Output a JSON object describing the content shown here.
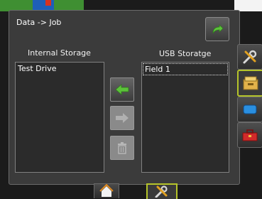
{
  "dialog": {
    "title": "Data -> Job",
    "internal_label": "Internal Storage",
    "usb_label": "USB Storatge",
    "internal_items": [
      "Test Drive"
    ],
    "usb_items": [
      "Field 1"
    ],
    "selected_usb_item": "Field 1"
  },
  "buttons": {
    "back_icon": "curved-arrow-icon",
    "copy_to_internal_icon": "arrow-left-icon",
    "copy_to_usb_icon": "arrow-right-icon",
    "delete_icon": "trash-icon"
  },
  "side_tabs": [
    {
      "icon": "tools-icon",
      "active": false
    },
    {
      "icon": "data-folder-icon",
      "active": true
    },
    {
      "icon": "blue-shape-icon",
      "active": false
    },
    {
      "icon": "toolbox-icon",
      "active": false
    }
  ],
  "bottom_tabs": [
    {
      "icon": "home-icon",
      "active": false
    },
    {
      "icon": "tools-icon",
      "active": true
    }
  ],
  "colors": {
    "accent_active": "#b5c42a",
    "arrow_green": "#5cc23a",
    "dialog_bg": "#3b3b3b"
  }
}
